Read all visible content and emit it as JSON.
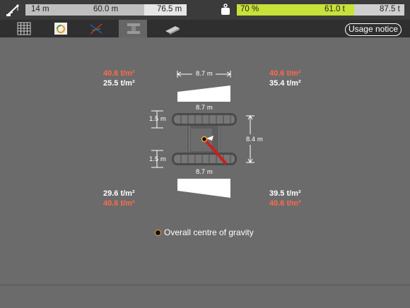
{
  "topbar": {
    "boom_gauge": {
      "radius": "14 m",
      "length": "60.0 m",
      "max": "76.5 m"
    },
    "load_gauge": {
      "percent": "70 %",
      "load": "61.0 t",
      "max": "87.5 t"
    },
    "icons": [
      "crane-boom-icon",
      "weight-icon"
    ]
  },
  "tabs": [
    {
      "name": "building-tab"
    },
    {
      "name": "load-chart-tab"
    },
    {
      "name": "boom-config-tab"
    },
    {
      "name": "ground-pressure-tab",
      "active": true
    },
    {
      "name": "mat-tab"
    }
  ],
  "usage_notice": "Usage notice",
  "pressures": {
    "top_left": {
      "max": "40.6 t/m²",
      "value": "25.5 t/m²"
    },
    "top_right": {
      "max": "40.6 t/m²",
      "value": "35.4 t/m²"
    },
    "bottom_left": {
      "value": "29.6 t/m²",
      "max": "40.6 t/m²"
    },
    "bottom_right": {
      "value": "39.5 t/m²",
      "max": "40.6 t/m²"
    }
  },
  "dimensions": {
    "top_width": "8.7 m",
    "track_width_top": "8.7 m",
    "track_width_bottom": "8.7 m",
    "track_height_top": "1.5 m",
    "track_height_bottom": "1.5 m",
    "track_gauge": "8.4 m"
  },
  "legend": {
    "cog": "Overall centre of gravity"
  },
  "colors": {
    "max_pressure": "#ff6a4d",
    "load_fill": "#c9e23a",
    "boom": "#c82020"
  }
}
